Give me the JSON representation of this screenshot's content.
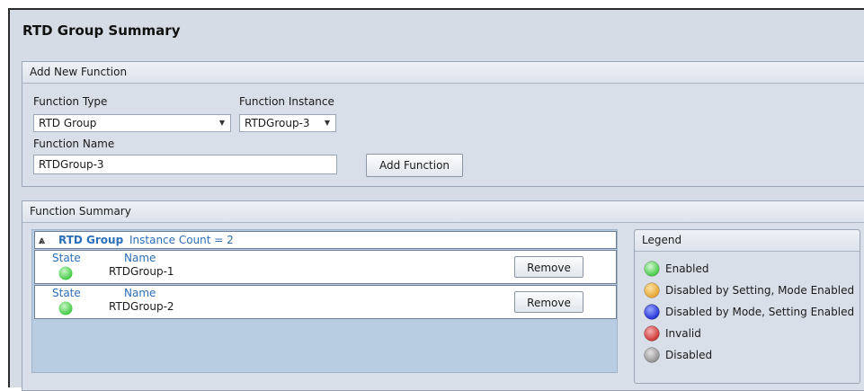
{
  "page": {
    "title": "RTD Group Summary"
  },
  "add_new": {
    "header": "Add New Function",
    "function_type_label": "Function Type",
    "function_type_value": "RTD Group",
    "function_instance_label": "Function Instance",
    "function_instance_value": "RTDGroup-3",
    "function_name_label": "Function Name",
    "function_name_value": "RTDGroup-3",
    "add_button": "Add Function"
  },
  "summary": {
    "header": "Function Summary",
    "group": {
      "name": "RTD Group",
      "count_text": "Instance Count = 2"
    },
    "columns": {
      "state": "State",
      "name": "Name"
    },
    "rows": [
      {
        "name": "RTDGroup-1",
        "state": "enabled",
        "remove_label": "Remove"
      },
      {
        "name": "RTDGroup-2",
        "state": "enabled",
        "remove_label": "Remove"
      }
    ]
  },
  "legend": {
    "title": "Legend",
    "items": [
      {
        "label": "Enabled",
        "color": "#3fc83f",
        "icon": "green-status-icon"
      },
      {
        "label": "Disabled by Setting, Mode Enabled",
        "color": "#e6a22a",
        "icon": "orange-status-icon"
      },
      {
        "label": "Disabled by Mode, Setting Enabled",
        "color": "#1f2fd6",
        "icon": "blue-status-icon"
      },
      {
        "label": "Invalid",
        "color": "#cc3030",
        "icon": "red-status-icon"
      },
      {
        "label": "Disabled",
        "color": "#8f8f8f",
        "icon": "gray-status-icon"
      }
    ]
  }
}
